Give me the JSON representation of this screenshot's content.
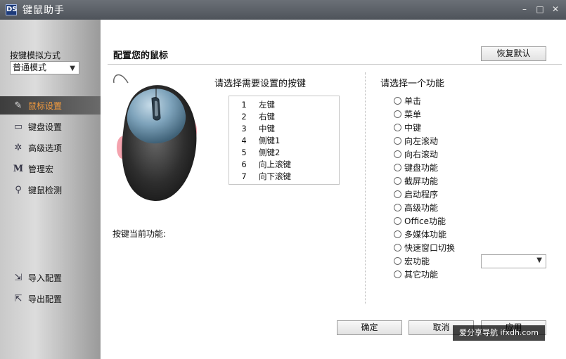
{
  "window": {
    "title": "键鼠助手",
    "icon_text": "DS",
    "controls": {
      "minimize": "–",
      "maximize": "□",
      "close": "✕"
    }
  },
  "sidebar": {
    "mode_label": "按键模拟方式",
    "mode_value": "普通模式",
    "items": [
      {
        "label": "鼠标设置",
        "icon": "mouse-icon",
        "active": true
      },
      {
        "label": "键盘设置",
        "icon": "keyboard-icon"
      },
      {
        "label": "高级选项",
        "icon": "gear-icon"
      },
      {
        "label": "管理宏",
        "icon": "macro-icon"
      },
      {
        "label": "键鼠检测",
        "icon": "search-icon"
      }
    ],
    "import_label": "导入配置",
    "export_label": "导出配置"
  },
  "main": {
    "title": "配置您的鼠标",
    "restore_label": "恢复默认",
    "key_heading": "请选择需要设置的按键",
    "keys": [
      {
        "index": "1",
        "name": "左键"
      },
      {
        "index": "2",
        "name": "右键"
      },
      {
        "index": "3",
        "name": "中键"
      },
      {
        "index": "4",
        "name": "侧键1"
      },
      {
        "index": "5",
        "name": "侧键2"
      },
      {
        "index": "6",
        "name": "向上滚键"
      },
      {
        "index": "7",
        "name": "向下滚键"
      }
    ],
    "current_function_label": "按键当前功能:",
    "function_heading": "请选择一个功能",
    "functions": [
      "单击",
      "菜单",
      "中键",
      "向左滚动",
      "向右滚动",
      "键盘功能",
      "截屏功能",
      "启动程序",
      "高级功能",
      "Office功能",
      "多媒体功能",
      "快速窗口切换",
      "宏功能",
      "其它功能"
    ],
    "ok_label": "确定",
    "cancel_label": "取消",
    "apply_label": "应用"
  },
  "watermark": "爱分享导航 ifxdh.com",
  "colors": {
    "active_nav_text": "#f19a3e",
    "titlebar": "#5a5f66"
  }
}
